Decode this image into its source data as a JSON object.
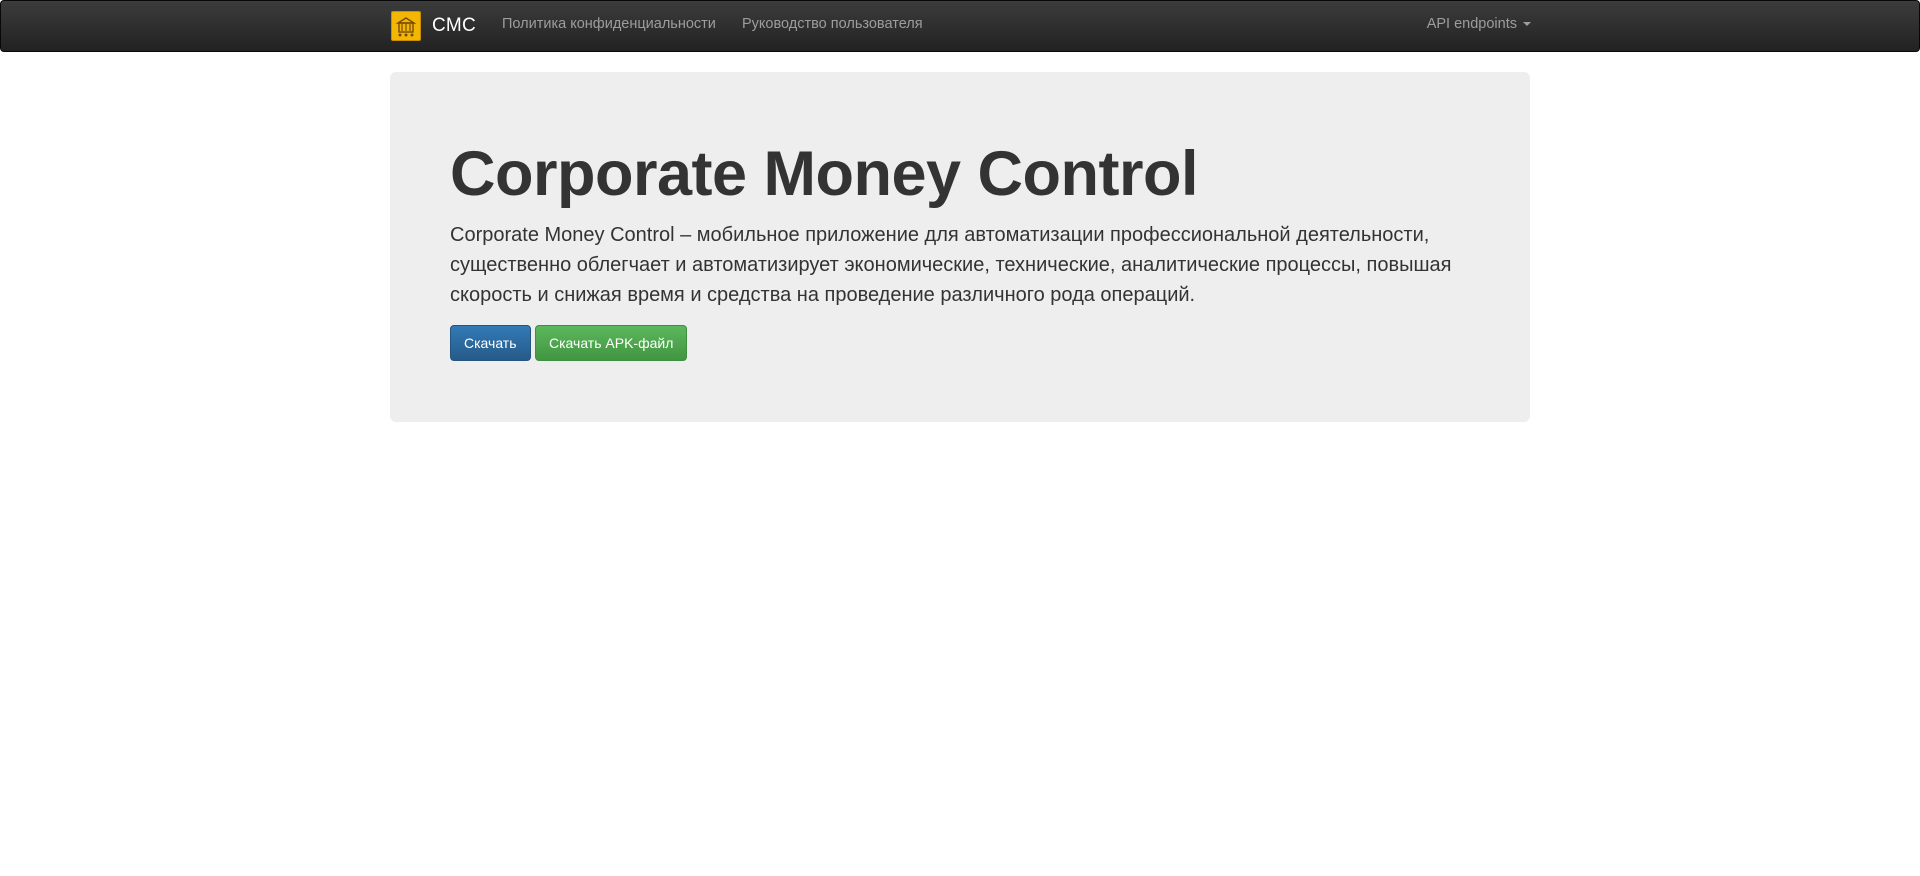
{
  "navbar": {
    "brand": "CMC",
    "brand_logo_icon": "building-logo-icon",
    "links": {
      "privacy": "Политика конфиденциальности",
      "guide": "Руководство пользователя",
      "api": "API endpoints"
    }
  },
  "jumbotron": {
    "title": "Corporate Money Control",
    "lead": "Corporate Money Control – мобильное приложение для автоматизации профессиональной деятельности, существенно облегчает и автоматизирует экономические, технические, аналитические процессы, повышая скорость и снижая время и средства на проведение различного рода операций.",
    "download_button": "Скачать",
    "download_apk_button": "Скачать APK-файл"
  },
  "colors": {
    "navbar_bg": "#222222",
    "jumbotron_bg": "#eeeeee",
    "primary": "#337ab7",
    "success": "#5cb85c",
    "logo": "#f2b705"
  }
}
